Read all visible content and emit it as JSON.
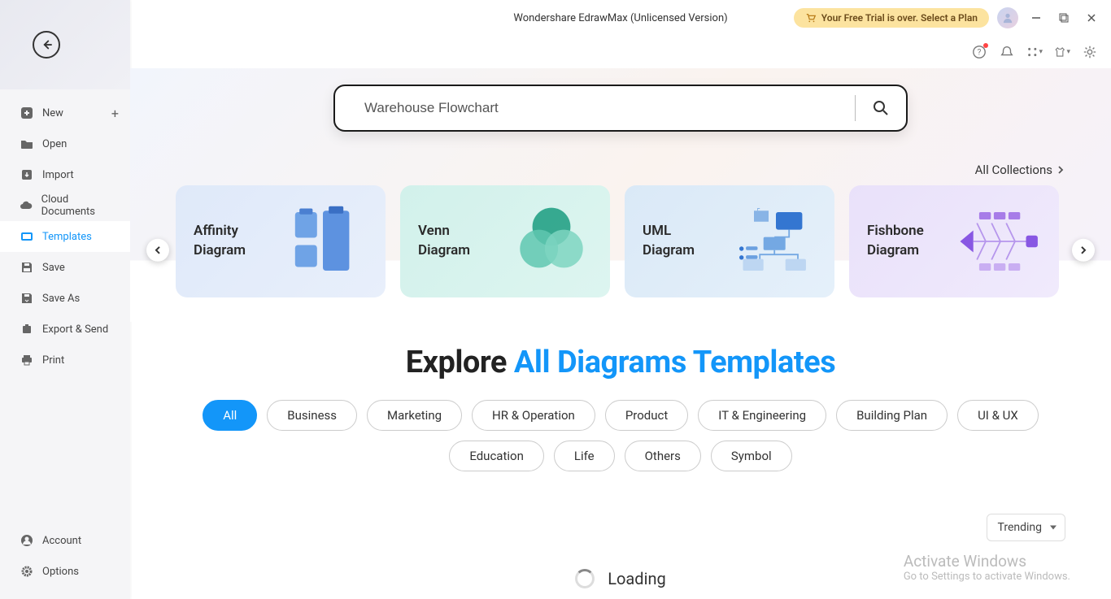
{
  "title": "Wondershare EdrawMax (Unlicensed Version)",
  "trial_banner": "Your Free Trial is over. Select a Plan",
  "sidebar": {
    "items": [
      {
        "label": "New",
        "icon": "plus-square",
        "has_plus": true
      },
      {
        "label": "Open",
        "icon": "folder"
      },
      {
        "label": "Import",
        "icon": "import"
      },
      {
        "label": "Cloud Documents",
        "icon": "cloud"
      },
      {
        "label": "Templates",
        "icon": "template",
        "active": true
      },
      {
        "label": "Save",
        "icon": "save"
      },
      {
        "label": "Save As",
        "icon": "save-as"
      },
      {
        "label": "Export & Send",
        "icon": "export"
      },
      {
        "label": "Print",
        "icon": "print"
      }
    ],
    "bottom_items": [
      {
        "label": "Account",
        "icon": "user"
      },
      {
        "label": "Options",
        "icon": "gear"
      }
    ]
  },
  "search": {
    "value": "Warehouse Flowchart"
  },
  "all_collections": "All Collections",
  "cards": [
    {
      "title": "Affinity Diagram",
      "theme": "c-blue"
    },
    {
      "title": "Venn Diagram",
      "theme": "c-teal"
    },
    {
      "title": "UML Diagram",
      "theme": "c-blue2"
    },
    {
      "title": "Fishbone Diagram",
      "theme": "c-purple"
    }
  ],
  "explore": {
    "heading_dark": "Explore ",
    "heading_blue": "All Diagrams Templates"
  },
  "pills": [
    "All",
    "Business",
    "Marketing",
    "HR & Operation",
    "Product",
    "IT & Engineering",
    "Building Plan",
    "UI & UX",
    "Education",
    "Life",
    "Others",
    "Symbol"
  ],
  "active_pill": "All",
  "sort": "Trending",
  "loading": "Loading",
  "watermark": {
    "title": "Activate Windows",
    "sub": "Go to Settings to activate Windows."
  }
}
